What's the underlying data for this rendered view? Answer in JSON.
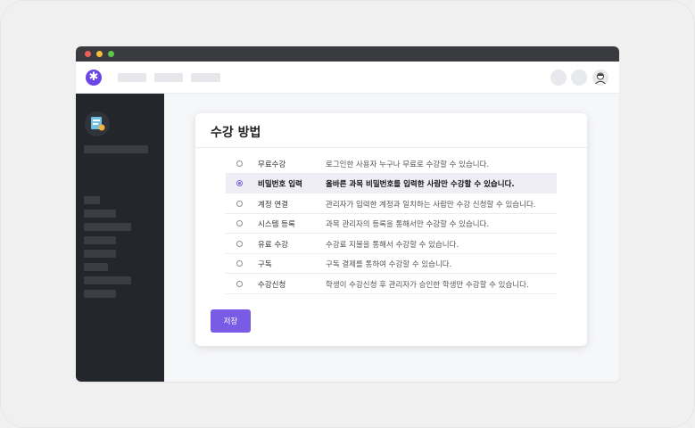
{
  "card": {
    "title": "수강 방법",
    "save_label": "저장"
  },
  "options": [
    {
      "label": "무료수강",
      "desc": "로그인한 사용자 누구나 무료로 수강할 수 있습니다.",
      "selected": false
    },
    {
      "label": "비밀번호 입력",
      "desc": "올바른 과목 비밀번호를 입력한 사람만 수강할 수 있습니다.",
      "selected": true
    },
    {
      "label": "계정 연결",
      "desc": "관리자가 입력한 계정과 일치하는 사람만 수강 신청할 수 있습니다.",
      "selected": false
    },
    {
      "label": "시스템 등록",
      "desc": "과목 관리자의 등록을 통해서만 수강할 수 있습니다.",
      "selected": false
    },
    {
      "label": "유료 수강",
      "desc": "수강료 지불을 통해서 수강할 수 있습니다.",
      "selected": false
    },
    {
      "label": "구독",
      "desc": "구독 결제를 통하여 수강할 수 있습니다.",
      "selected": false
    },
    {
      "label": "수강신청",
      "desc": "학생이 수강신청 후 관리자가 승인한 학생만 수강할 수 있습니다.",
      "selected": false
    }
  ],
  "colors": {
    "accent": "#7a5be6",
    "logo": "#6b46e5",
    "sidebar": "#23262b",
    "titlebar": "#3a3b3f"
  },
  "icons": {
    "logo": "star-logo-icon",
    "avatar": "user-avatar-icon"
  }
}
